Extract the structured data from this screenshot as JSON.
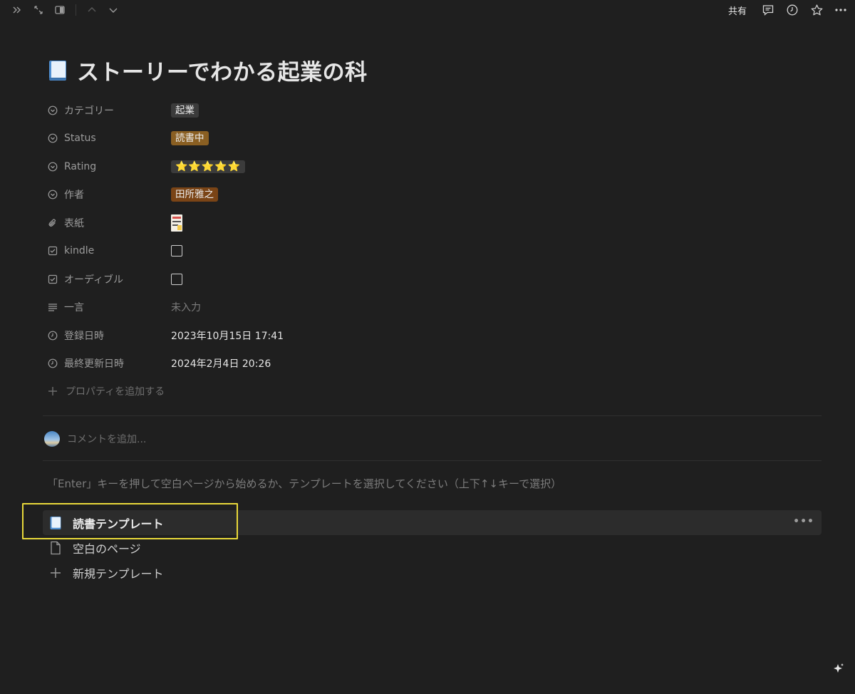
{
  "topbar": {
    "share_label": "共有",
    "left_icons": [
      "double-chevron-right-icon",
      "expand-icon",
      "sidebar-panel-icon",
      "chevron-up-icon",
      "chevron-down-icon"
    ],
    "right_icons": [
      "comment-icon",
      "history-clock-icon",
      "star-icon",
      "more-icon"
    ]
  },
  "page": {
    "icon": "book-icon",
    "title": "ストーリーでわかる起業の科"
  },
  "properties": [
    {
      "label": "カテゴリー",
      "icon": "select-icon",
      "type": "tag",
      "value": "起業",
      "color": "#3b3b3b"
    },
    {
      "label": "Status",
      "icon": "select-icon",
      "type": "tag",
      "value": "読書中",
      "color": "#8a5f22"
    },
    {
      "label": "Rating",
      "icon": "select-icon",
      "type": "stars",
      "value": "⭐⭐⭐⭐⭐",
      "rating": 5
    },
    {
      "label": "作者",
      "icon": "select-icon",
      "type": "tag",
      "value": "田所雅之",
      "color": "#7a4416"
    },
    {
      "label": "表紙",
      "icon": "paperclip-icon",
      "type": "image",
      "value": ""
    },
    {
      "label": "kindle",
      "icon": "checkbox-icon",
      "type": "checkbox",
      "checked": false
    },
    {
      "label": "オーディブル",
      "icon": "checkbox-icon",
      "type": "checkbox",
      "checked": false
    },
    {
      "label": "一言",
      "icon": "text-lines-icon",
      "type": "text",
      "value": "未入力",
      "empty": true
    },
    {
      "label": "登録日時",
      "icon": "clock-icon",
      "type": "text",
      "value": "2023年10月15日 17:41"
    },
    {
      "label": "最終更新日時",
      "icon": "clock-icon",
      "type": "text",
      "value": "2024年2月4日 20:26"
    }
  ],
  "add_property_label": "プロパティを追加する",
  "comment_placeholder": "コメントを追加...",
  "template_hint": "「Enter」キーを押して空白ページから始めるか、テンプレートを選択してください（上下↑↓キーで選択）",
  "templates": [
    {
      "label": "読書テンプレート",
      "icon": "book-icon",
      "selected": true
    },
    {
      "label": "空白のページ",
      "icon": "page-icon",
      "selected": false
    },
    {
      "label": "新規テンプレート",
      "icon": "plus-icon",
      "selected": false
    }
  ],
  "template_more": "•••",
  "colors": {
    "background": "#1f1f1f",
    "highlight": "#e8d83a",
    "selected_row": "#2c2c2c"
  }
}
